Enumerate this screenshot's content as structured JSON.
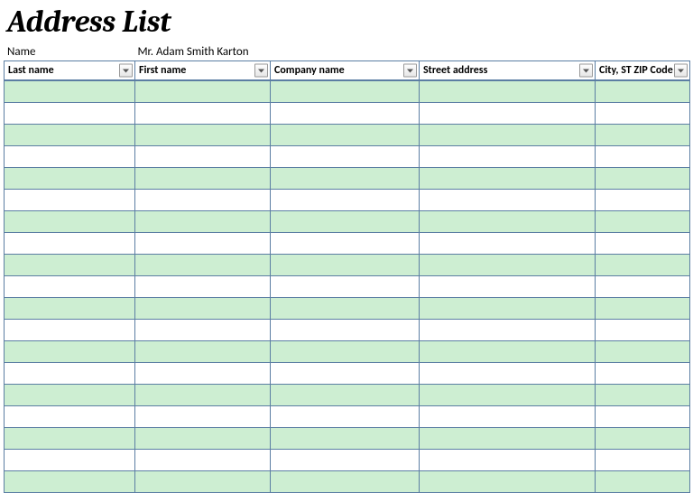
{
  "title": "Address List",
  "meta": {
    "label": "Name",
    "value": "Mr. Adam Smith Karton"
  },
  "columns": {
    "last_name": "Last name",
    "first_name": "First name",
    "company_name": "Company name",
    "street_address": "Street address",
    "city_st_zip": "City, ST  ZIP Code"
  },
  "row_count": 19
}
